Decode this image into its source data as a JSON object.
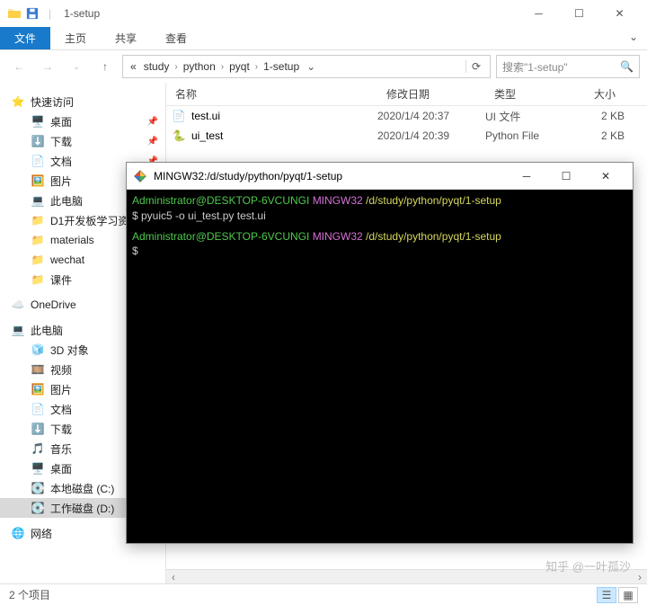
{
  "titlebar": {
    "title": "1-setup",
    "sep": "|"
  },
  "ribbon": {
    "file": "文件",
    "tabs": [
      "主页",
      "共享",
      "查看"
    ]
  },
  "breadcrumb": {
    "root": "«",
    "parts": [
      "study",
      "python",
      "pyqt",
      "1-setup"
    ]
  },
  "search": {
    "placeholder": "搜索\"1-setup\""
  },
  "columns": {
    "name": "名称",
    "date": "修改日期",
    "type": "类型",
    "size": "大小"
  },
  "files": [
    {
      "name": "test.ui",
      "date": "2020/1/4 20:37",
      "type": "UI 文件",
      "size": "2 KB"
    },
    {
      "name": "ui_test",
      "date": "2020/1/4 20:39",
      "type": "Python File",
      "size": "2 KB"
    }
  ],
  "sidebar": {
    "quick": {
      "label": "快速访问",
      "items": [
        "桌面",
        "下载",
        "文档",
        "图片",
        "此电脑",
        "D1开发板学习资",
        "materials",
        "wechat",
        "课件"
      ]
    },
    "onedrive": "OneDrive",
    "thispc": {
      "label": "此电脑",
      "items": [
        "3D 对象",
        "视频",
        "图片",
        "文档",
        "下载",
        "音乐",
        "桌面",
        "本地磁盘 (C:)",
        "工作磁盘 (D:)"
      ]
    },
    "network": "网络"
  },
  "statusbar": {
    "count": "2 个项目"
  },
  "terminal": {
    "title": "MINGW32:/d/study/python/pyqt/1-setup",
    "prompt_user": "Administrator@DESKTOP-6VCUNGI",
    "prompt_sys": "MINGW32",
    "prompt_path": "/d/study/python/pyqt/1-setup",
    "cmd": "$ pyuic5 -o ui_test.py test.ui",
    "prompt2": "$"
  },
  "watermark": "知乎 @一叶孤沙"
}
